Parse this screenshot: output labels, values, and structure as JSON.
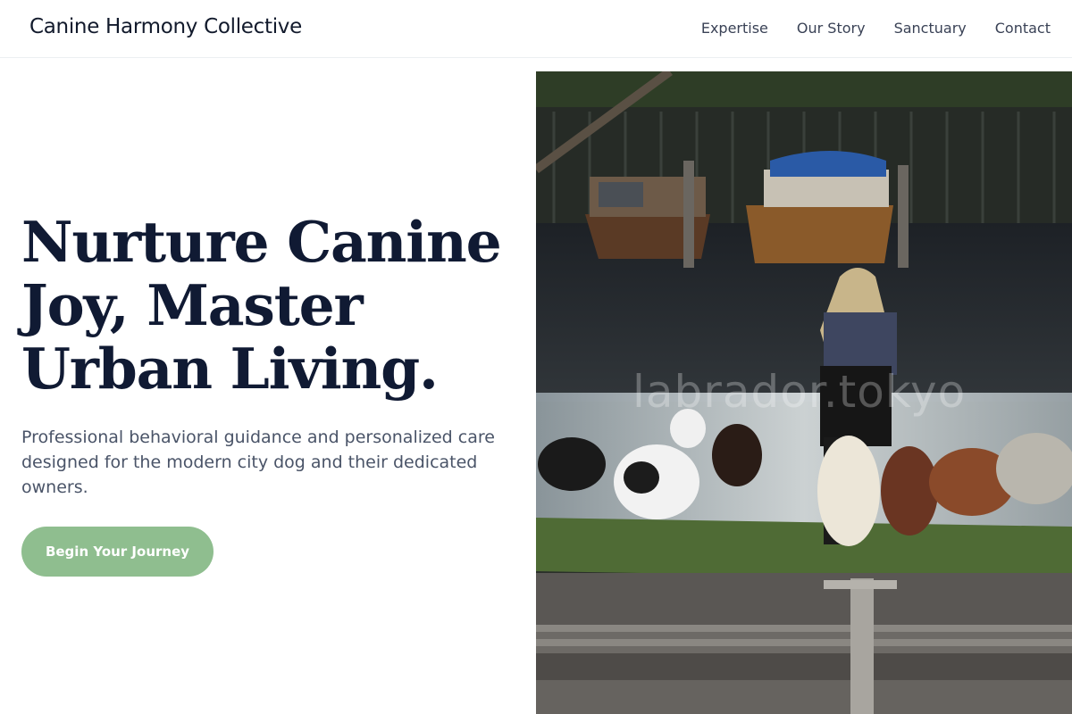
{
  "header": {
    "brand": "Canine Harmony Collective",
    "nav": [
      {
        "label": "Expertise"
      },
      {
        "label": "Our Story"
      },
      {
        "label": "Sanctuary"
      },
      {
        "label": "Contact"
      }
    ]
  },
  "hero": {
    "title_lines": [
      "Nurture Canine",
      "Joy, Master",
      "Urban Living."
    ],
    "subtitle": "Professional behavioral guidance and personalized care designed for the modern city dog and their dedicated owners.",
    "cta_label": "Begin Your Journey"
  },
  "photo": {
    "watermark": "labrador.tokyo"
  },
  "colors": {
    "accent": "#8fbe8f",
    "heading": "#101a33",
    "body_text": "#4a5468",
    "nav_text": "#3a4256"
  }
}
